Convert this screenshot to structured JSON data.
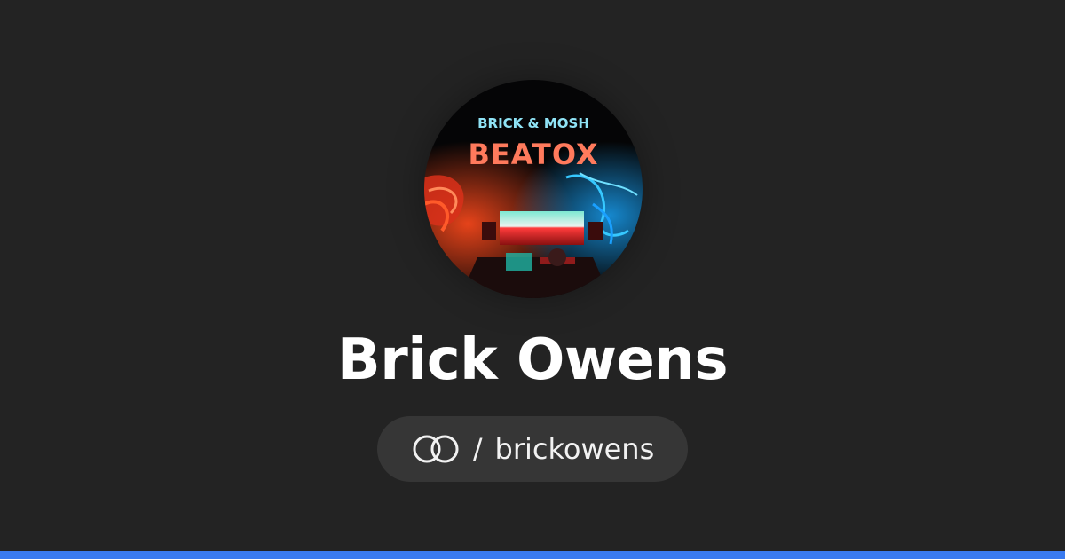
{
  "profile": {
    "name": "Brick Owens",
    "handle_separator": "/",
    "handle": "brickowens",
    "avatar": {
      "top_text": "BRICK & MOSH",
      "main_text": "BEATOX"
    }
  },
  "colors": {
    "background": "#232323",
    "pill": "#363636",
    "bottom_bar": "#3a7bf0",
    "avatar_top_text": "#8fe3f5",
    "avatar_main_text": "#ff7a5c"
  },
  "icons": {
    "handle_icon": "linked-rings-icon"
  }
}
